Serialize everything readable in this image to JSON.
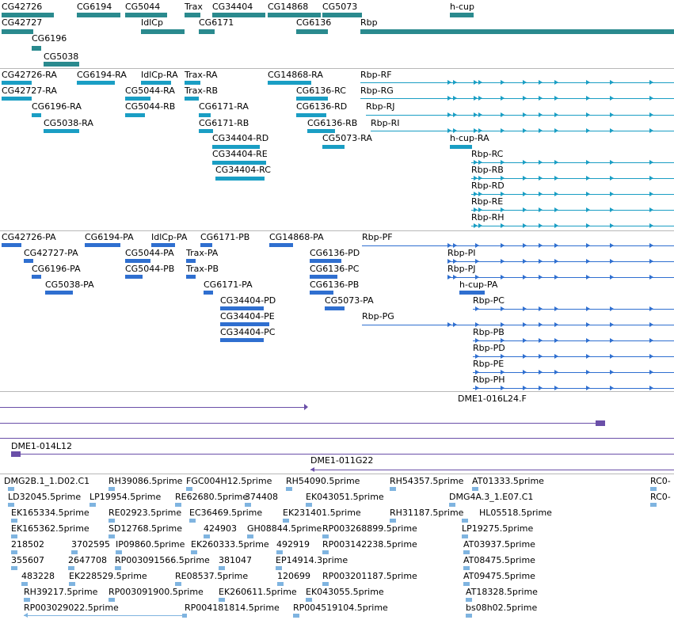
{
  "colors": {
    "gene": "#2a8a8e",
    "transcript_rna": "#1a9ec4",
    "transcript_prot": "#2f6fd0",
    "clone": "#6a4fa8",
    "est": "#7fb4e0",
    "separator": "#b8b8b8"
  },
  "tracks": {
    "genes": {
      "labels": [
        "CG42726",
        "CG6194",
        "CG5044",
        "Trax",
        "CG34404",
        "CG14868",
        "CG5073",
        "h-cup",
        "CG42727",
        "IdlCp",
        "CG6171",
        "CG6136",
        "Rbp",
        "CG6196",
        "CG5038"
      ]
    },
    "transcripts": {
      "labels": [
        "CG42726-RA",
        "CG6194-RA",
        "IdlCp-RA",
        "Trax-RA",
        "CG14868-RA",
        "Rbp-RF",
        "CG42727-RA",
        "CG5044-RA",
        "Trax-RB",
        "CG6136-RC",
        "Rbp-RG",
        "CG6196-RA",
        "CG5044-RB",
        "CG6171-RA",
        "CG6136-RD",
        "Rbp-RJ",
        "CG5038-RA",
        "CG6171-RB",
        "CG6136-RB",
        "Rbp-RI",
        "CG34404-RD",
        "CG5073-RA",
        "h-cup-RA",
        "CG34404-RE",
        "Rbp-RC",
        "CG34404-RC",
        "Rbp-RB",
        "Rbp-RD",
        "Rbp-RE",
        "Rbp-RH"
      ]
    },
    "proteins": {
      "labels": [
        "CG42726-PA",
        "CG6194-PA",
        "IdlCp-PA",
        "CG6171-PB",
        "CG14868-PA",
        "Rbp-PF",
        "CG42727-PA",
        "CG5044-PA",
        "Trax-PA",
        "CG6136-PD",
        "Rbp-PI",
        "CG6196-PA",
        "CG5044-PB",
        "Trax-PB",
        "CG6136-PC",
        "Rbp-PJ",
        "CG5038-PA",
        "CG6171-PA",
        "CG6136-PB",
        "h-cup-PA",
        "CG34404-PD",
        "CG5073-PA",
        "Rbp-PC",
        "CG34404-PE",
        "Rbp-PG",
        "Rbp-PB",
        "CG34404-PC",
        "Rbp-PD",
        "Rbp-PE",
        "Rbp-PH"
      ]
    },
    "clones": {
      "labels": [
        "DME1-016L24.F",
        "DME1-014L12",
        "DME1-011G22"
      ]
    },
    "ests": {
      "labels": [
        "DMG2B.1_1.D02.C1",
        "RH39086.5prime",
        "FGC004H12.5prime",
        "RH54090.5prime",
        "RH54357.5prime",
        "AT01333.5prime",
        "RC0-",
        "LD32045.5prime",
        "LP19954.5prime",
        "RE62680.5prime",
        "374408",
        "EK043051.5prime",
        "DMG4A.3_1.E07.C1",
        "RC0-",
        "EK165334.5prime",
        "RE02923.5prime",
        "EC36469.5prime",
        "EK231401.5prime",
        "RH31187.5prime",
        "HL05518.5prime",
        "EK165362.5prime",
        "SD12768.5prime",
        "424903",
        "GH08844.5prime",
        "RP003268899.5prime",
        "LP19275.5prime",
        "218502",
        "3702595",
        "IP09860.5prime",
        "EK260333.5prime",
        "492919",
        "RP003142238.5prime",
        "AT03937.5prime",
        "355607",
        "2647708",
        "RP003091566.5prime",
        "381047",
        "EP14914.3prime",
        "AT08475.5prime",
        "483228",
        "EK228529.5prime",
        "RE08537.5prime",
        "120699",
        "RP003201187.5prime",
        "AT09475.5prime",
        "RH39217.5prime",
        "RP003091900.5prime",
        "EK260611.5prime",
        "EK043055.5prime",
        "AT18328.5prime",
        "RP003029022.5prime",
        "RP004181814.5prime",
        "RP004519104.5prime",
        "bs08h02.5prime"
      ]
    }
  }
}
